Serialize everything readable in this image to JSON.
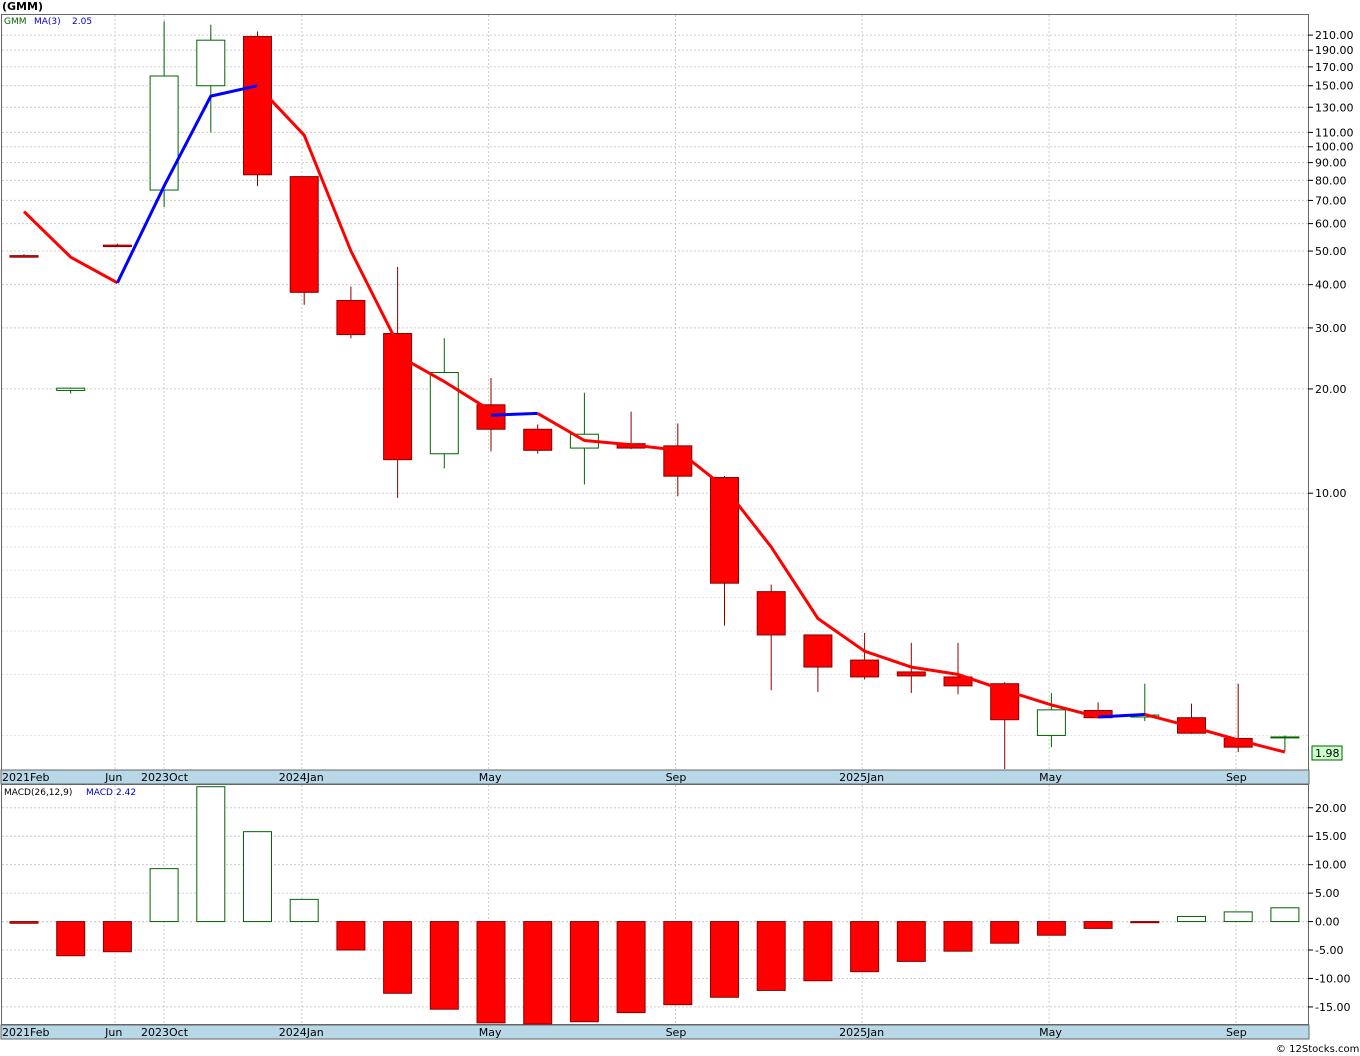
{
  "ticker_title": "(GMM)",
  "legend": {
    "symbol": "GMM",
    "ma_label": "MA(3)",
    "ma_value": "2.05",
    "macd_label": "MACD(26,12,9)",
    "macd_name": "MACD",
    "macd_value": "2.42"
  },
  "last_price_label": "1.98",
  "watermark": "© 12Stocks.com",
  "month_labels": [
    {
      "text": "2021Feb",
      "idx": -0.75
    },
    {
      "text": "Jun",
      "idx": 1.95
    },
    {
      "text": "2023Oct",
      "idx": 3.0
    },
    {
      "text": "2024Jan",
      "idx": 5.95
    },
    {
      "text": "May",
      "idx": 9.95
    },
    {
      "text": "Sep",
      "idx": 13.95
    },
    {
      "text": "2025Jan",
      "idx": 17.95
    },
    {
      "text": "May",
      "idx": 21.95
    },
    {
      "text": "Sep",
      "idx": 25.95
    }
  ],
  "colors": {
    "up_fill": "#ffffff",
    "up_stroke": "#006400",
    "down_fill": "#ff0000",
    "down_stroke": "#8b0000",
    "ma_down": "#ff0000",
    "ma_up": "#0000ff",
    "grid": "#cccccc",
    "axis_bar": "#b8d8e8",
    "last_price_bg": "#ccffcc"
  },
  "chart_data": [
    {
      "type": "candlestick",
      "scale": "log",
      "ylim": [
        1.6,
        240
      ],
      "y_ticks": [
        10,
        20,
        30,
        40,
        50,
        60,
        70,
        80,
        90,
        100,
        110,
        130,
        150,
        170,
        190,
        210
      ],
      "y_tick_labels": [
        "10.00",
        "20.00",
        "30.00",
        "40.00",
        "50.00",
        "60.00",
        "70.00",
        "80.00",
        "90.00",
        "100.00",
        "110.00",
        "130.00",
        "150.00",
        "170.00",
        "190.00",
        "210.00"
      ],
      "candles": [
        {
          "o": 48.5,
          "h": 49,
          "l": 48,
          "c": 48
        },
        {
          "o": 19.8,
          "h": 20.2,
          "l": 19.4,
          "c": 20.1
        },
        {
          "o": 52,
          "h": 52.5,
          "l": 51.5,
          "c": 51.5
        },
        {
          "o": 75,
          "h": 230,
          "l": 67,
          "c": 160
        },
        {
          "o": 150,
          "h": 225,
          "l": 110,
          "c": 203
        },
        {
          "o": 208,
          "h": 215,
          "l": 77,
          "c": 83
        },
        {
          "o": 82,
          "h": 82,
          "l": 35,
          "c": 38
        },
        {
          "o": 36,
          "h": 39.5,
          "l": 28,
          "c": 28.7
        },
        {
          "o": 28.9,
          "h": 45,
          "l": 9.7,
          "c": 12.5
        },
        {
          "o": 13.0,
          "h": 28,
          "l": 11.8,
          "c": 22.3
        },
        {
          "o": 18.0,
          "h": 21.5,
          "l": 13.2,
          "c": 15.3
        },
        {
          "o": 15.3,
          "h": 15.8,
          "l": 13.0,
          "c": 13.3
        },
        {
          "o": 13.5,
          "h": 19.5,
          "l": 10.6,
          "c": 14.8
        },
        {
          "o": 13.9,
          "h": 17.2,
          "l": 13.4,
          "c": 13.5
        },
        {
          "o": 13.7,
          "h": 15.9,
          "l": 9.8,
          "c": 11.2
        },
        {
          "o": 11.1,
          "h": 11.2,
          "l": 4.15,
          "c": 5.5
        },
        {
          "o": 5.2,
          "h": 5.45,
          "l": 2.7,
          "c": 3.9
        },
        {
          "o": 3.9,
          "h": 3.9,
          "l": 2.67,
          "c": 3.15
        },
        {
          "o": 3.3,
          "h": 3.95,
          "l": 2.9,
          "c": 2.95
        },
        {
          "o": 3.05,
          "h": 3.7,
          "l": 2.65,
          "c": 2.97
        },
        {
          "o": 2.95,
          "h": 3.7,
          "l": 2.63,
          "c": 2.78
        },
        {
          "o": 2.82,
          "h": 2.85,
          "l": 1.6,
          "c": 2.22
        },
        {
          "o": 2.0,
          "h": 2.65,
          "l": 1.85,
          "c": 2.37
        },
        {
          "o": 2.36,
          "h": 2.49,
          "l": 2.26,
          "c": 2.25
        },
        {
          "o": 2.26,
          "h": 2.82,
          "l": 2.2,
          "c": 2.29
        },
        {
          "o": 2.25,
          "h": 2.47,
          "l": 2.02,
          "c": 2.03
        },
        {
          "o": 1.96,
          "h": 2.82,
          "l": 1.79,
          "c": 1.85
        },
        {
          "o": 1.97,
          "h": 2.0,
          "l": 1.8,
          "c": 1.98
        }
      ],
      "ma_segments": [
        {
          "color": "down",
          "points": [
            [
              0,
              65
            ],
            [
              1,
              48
            ],
            [
              2,
              40.5
            ]
          ]
        },
        {
          "color": "up",
          "points": [
            [
              2,
              40.5
            ],
            [
              3,
              77
            ],
            [
              4,
              140
            ],
            [
              5,
              150
            ]
          ]
        },
        {
          "color": "down",
          "points": [
            [
              5,
              150
            ],
            [
              6,
              108
            ],
            [
              7,
              50
            ],
            [
              8,
              27
            ]
          ]
        },
        {
          "color": "down",
          "points": [
            [
              8,
              25
            ],
            [
              9,
              21
            ],
            [
              10,
              17.3
            ]
          ]
        },
        {
          "color": "up",
          "points": [
            [
              10,
              16.8
            ],
            [
              11,
              17
            ]
          ]
        },
        {
          "color": "down",
          "points": [
            [
              11,
              17
            ],
            [
              12,
              14.2
            ],
            [
              13,
              13.8
            ],
            [
              14,
              13.3
            ],
            [
              15,
              10.4
            ],
            [
              16,
              7.0
            ],
            [
              17,
              4.35
            ],
            [
              18,
              3.5
            ],
            [
              19,
              3.15
            ],
            [
              20,
              3.0
            ],
            [
              21,
              2.7
            ],
            [
              22,
              2.45
            ],
            [
              23,
              2.26
            ]
          ]
        },
        {
          "color": "up",
          "points": [
            [
              23,
              2.26
            ],
            [
              24,
              2.3
            ]
          ]
        },
        {
          "color": "down",
          "points": [
            [
              24,
              2.3
            ],
            [
              25,
              2.12
            ],
            [
              26,
              1.94
            ],
            [
              27,
              1.79
            ]
          ]
        }
      ]
    },
    {
      "type": "bar",
      "title": "MACD(26,12,9)",
      "ylim": [
        -18,
        24
      ],
      "y_ticks": [
        -15,
        -10,
        -5,
        0,
        5,
        10,
        15,
        20
      ],
      "y_tick_labels": [
        "-15.00",
        "-10.00",
        "-5.00",
        "0.00",
        "5.00",
        "10.00",
        "15.00",
        "20.00"
      ],
      "values": [
        -0.3,
        -6.0,
        -5.3,
        9.3,
        23.7,
        15.8,
        3.9,
        -5.0,
        -12.6,
        -15.4,
        -17.8,
        -18.0,
        -17.6,
        -16.0,
        -14.6,
        -13.3,
        -12.1,
        -10.4,
        -8.8,
        -7.0,
        -5.2,
        -3.8,
        -2.4,
        -1.2,
        -0.2,
        0.9,
        1.7,
        2.42
      ]
    }
  ]
}
